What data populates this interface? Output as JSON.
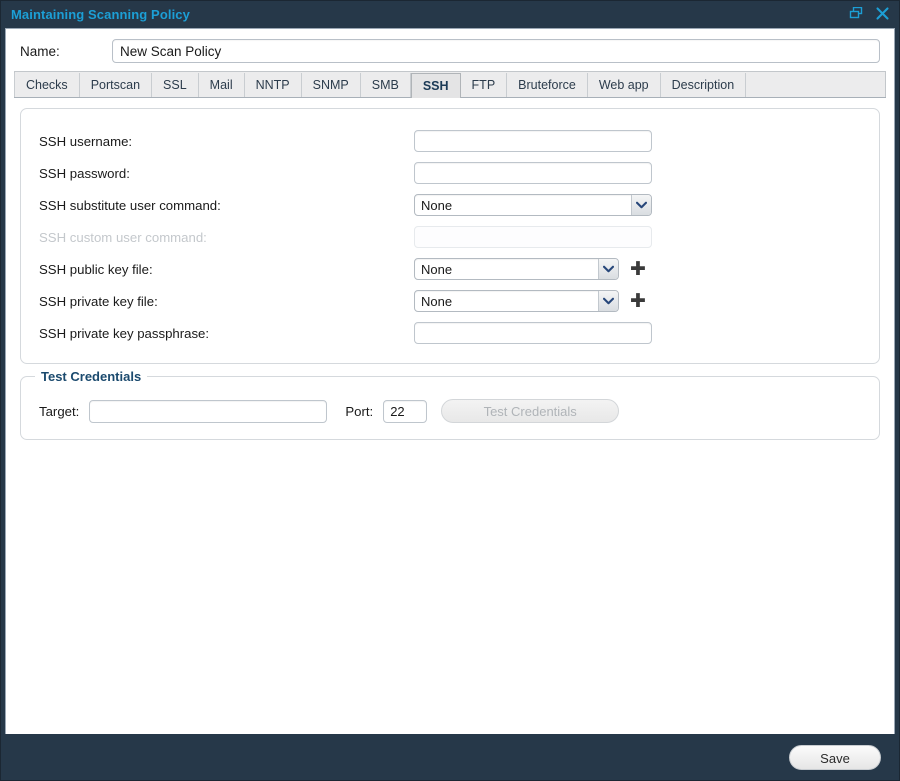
{
  "window": {
    "title": "Maintaining Scanning Policy",
    "title_color": "#1c9fd6",
    "chrome_color": "#263849",
    "restore_icon": "restore-window-icon",
    "close_icon": "close-icon"
  },
  "name_field": {
    "label": "Name:",
    "value": "New Scan Policy",
    "placeholder": ""
  },
  "tabs": [
    {
      "label": "Checks",
      "active": false
    },
    {
      "label": "Portscan",
      "active": false
    },
    {
      "label": "SSL",
      "active": false
    },
    {
      "label": "Mail",
      "active": false
    },
    {
      "label": "NNTP",
      "active": false
    },
    {
      "label": "SNMP",
      "active": false
    },
    {
      "label": "SMB",
      "active": false
    },
    {
      "label": "SSH",
      "active": true
    },
    {
      "label": "FTP",
      "active": false
    },
    {
      "label": "Bruteforce",
      "active": false
    },
    {
      "label": "Web app",
      "active": false
    },
    {
      "label": "Description",
      "active": false
    }
  ],
  "ssh_panel": {
    "fields": [
      {
        "label": "SSH username:",
        "type": "text",
        "value": "",
        "disabled": false,
        "plus": false
      },
      {
        "label": "SSH password:",
        "type": "text",
        "value": "",
        "disabled": false,
        "plus": false
      },
      {
        "label": "SSH substitute user command:",
        "type": "select",
        "value": "None",
        "disabled": false,
        "plus": false
      },
      {
        "label": "SSH custom user command:",
        "type": "text",
        "value": "",
        "disabled": true,
        "plus": false
      },
      {
        "label": "SSH public key file:",
        "type": "select",
        "value": "None",
        "disabled": false,
        "plus": true
      },
      {
        "label": "SSH private key file:",
        "type": "select",
        "value": "None",
        "disabled": false,
        "plus": true
      },
      {
        "label": "SSH private key passphrase:",
        "type": "text",
        "value": "",
        "disabled": false,
        "plus": false
      }
    ],
    "plus_icon": "plus-icon",
    "chevron_icon": "chevron-down-icon"
  },
  "test_credentials": {
    "legend": "Test Credentials",
    "target_label": "Target:",
    "target_value": "",
    "port_label": "Port:",
    "port_value": "22",
    "button_label": "Test Credentials",
    "button_disabled": true
  },
  "footer": {
    "save_label": "Save"
  }
}
